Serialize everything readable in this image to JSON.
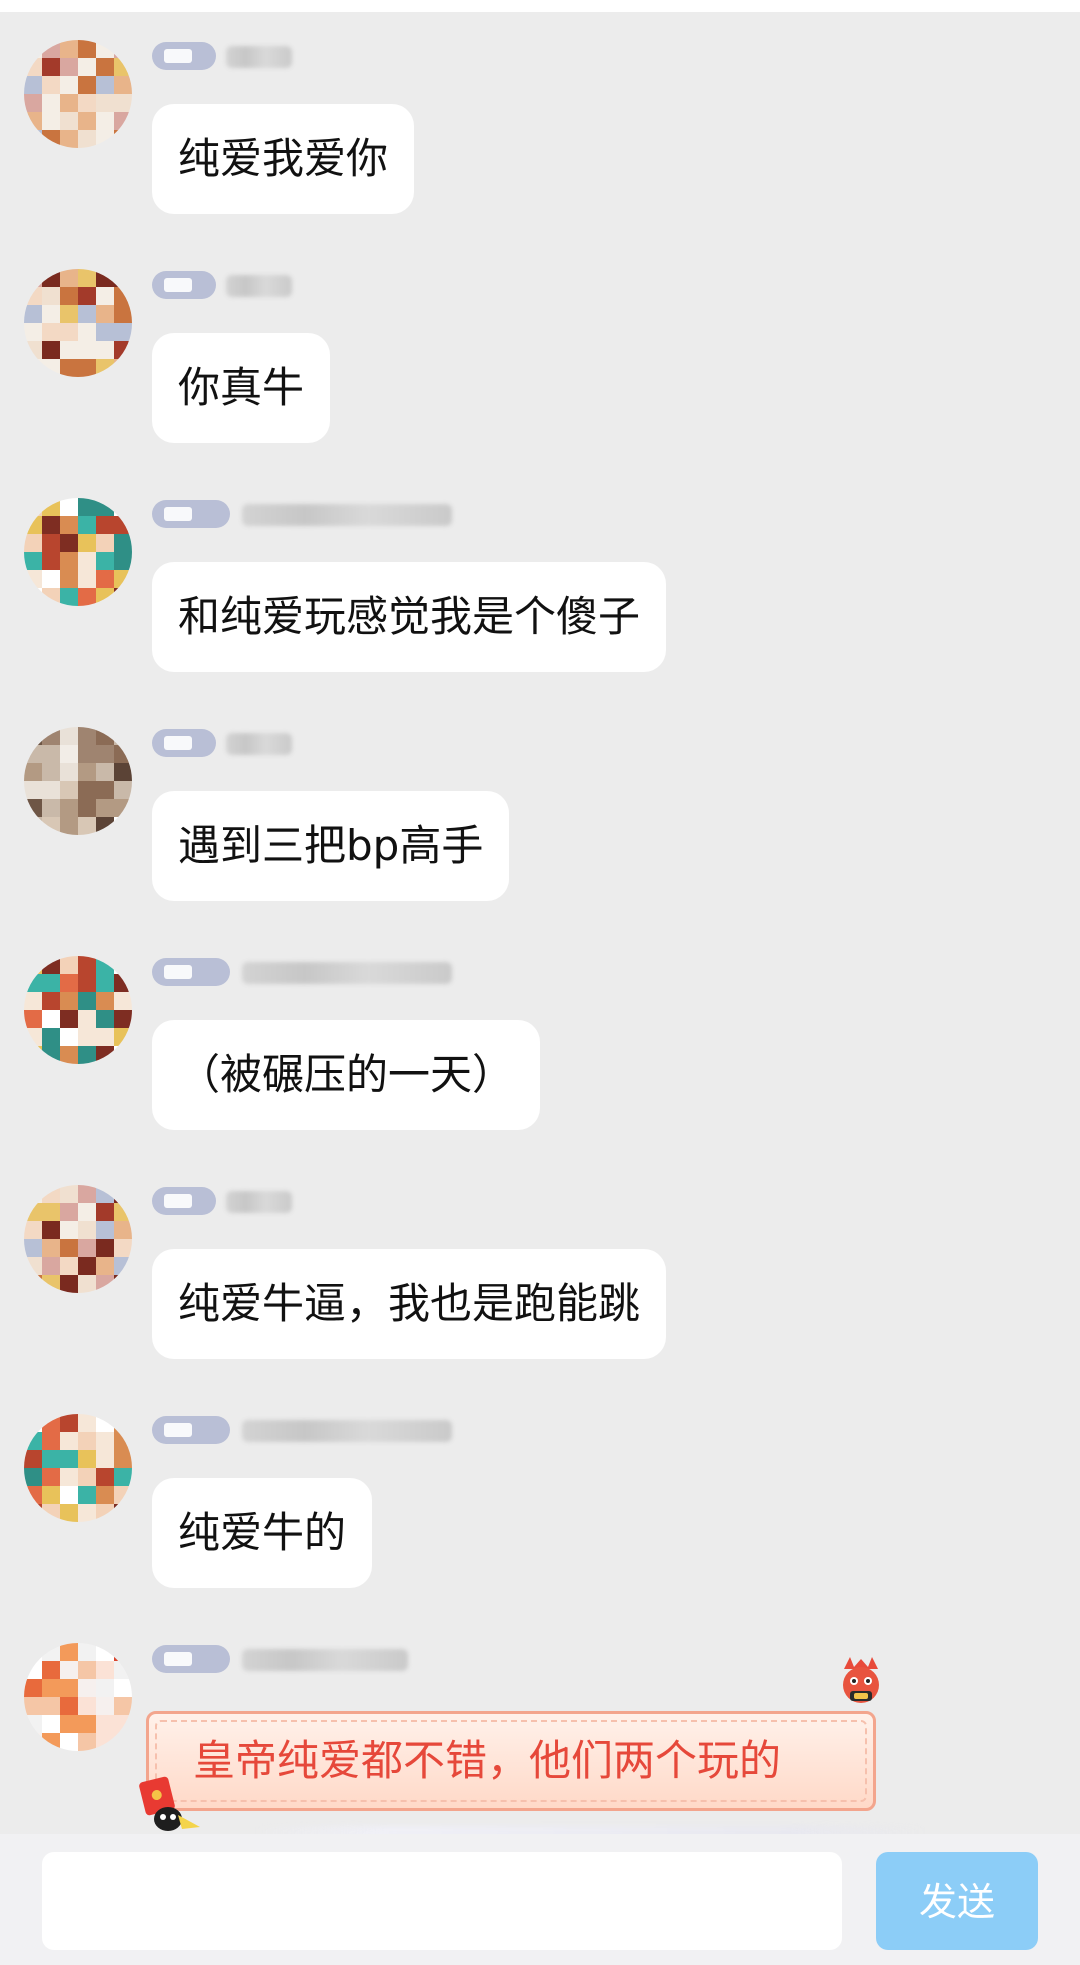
{
  "messages": [
    {
      "text": "纯爱我爱你",
      "avatar": "avatar-a"
    },
    {
      "text": "你真牛",
      "avatar": "avatar-a"
    },
    {
      "text": "和纯爱玩感觉我是个傻子",
      "avatar": "avatar-b"
    },
    {
      "text": "遇到三把bp高手",
      "avatar": "avatar-c"
    },
    {
      "text": "（被碾压的一天）",
      "avatar": "avatar-b"
    },
    {
      "text": "纯爱牛逼，我也是跑能跳",
      "avatar": "avatar-a"
    },
    {
      "text": "纯爱牛的",
      "avatar": "avatar-b"
    },
    {
      "text": "皇帝纯爱都不错，他们两个玩的",
      "avatar": "avatar-d",
      "style": "special-red-bubble"
    }
  ],
  "input": {
    "value": "",
    "placeholder": ""
  },
  "send_button": {
    "label": "发送"
  },
  "colors": {
    "background": "#ececec",
    "bubble": "#ffffff",
    "badge": "#b9bfd6",
    "special_text": "#e6483a",
    "send_button": "#8ccdf7"
  }
}
